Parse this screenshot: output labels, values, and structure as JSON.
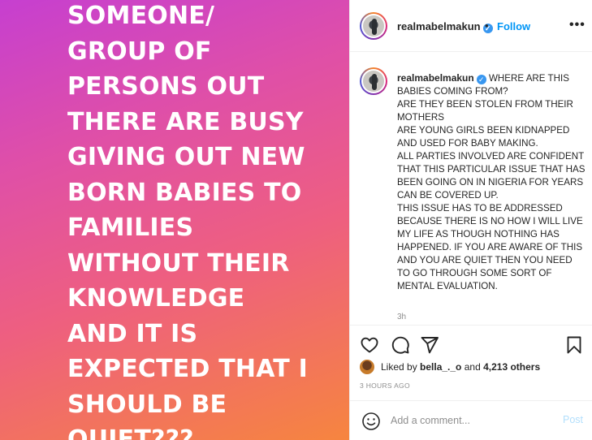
{
  "media": {
    "lines": [
      "SOMEONE/",
      "GROUP OF",
      "PERSONS OUT",
      "THERE ARE BUSY",
      "GIVING OUT NEW",
      "BORN BABIES TO",
      "FAMILIES",
      "WITHOUT THEIR",
      "KNOWLEDGE",
      "AND IT IS",
      "EXPECTED THAT I",
      "SHOULD BE",
      "QUIET???"
    ]
  },
  "header": {
    "username": "realmabelmakun",
    "separator": "•",
    "follow_label": "Follow",
    "more_label": "•••"
  },
  "caption": {
    "username": "realmabelmakun",
    "text": "WHERE ARE THIS BABIES COMING FROM?\nARE THEY BEEN STOLEN FROM THEIR MOTHERS\nARE YOUNG GIRLS BEEN KIDNAPPED AND USED FOR BABY MAKING.\nALL PARTIES INVOLVED ARE CONFIDENT THAT THIS PARTICULAR ISSUE THAT HAS BEEN GOING ON IN NIGERIA FOR YEARS CAN BE COVERED UP.\nTHIS ISSUE HAS TO BE ADDRESSED BECAUSE THERE IS NO HOW I WILL LIVE MY LIFE AS THOUGH NOTHING HAS HAPPENED. IF YOU ARE AWARE OF THIS AND YOU ARE QUIET THEN YOU NEED TO GO THROUGH SOME SORT OF MENTAL EVALUATION.",
    "time_ago": "3h"
  },
  "likes": {
    "prefix": "Liked by ",
    "user": "bella_._o",
    "middle": " and ",
    "count": "4,213 others"
  },
  "timestamp": "3 HOURS AGO",
  "comment": {
    "placeholder": "Add a comment...",
    "post_label": "Post"
  },
  "icons": {
    "like": "heart-icon",
    "comment": "comment-bubble-icon",
    "share": "paper-plane-icon",
    "save": "bookmark-icon",
    "emoji": "smiley-icon",
    "verified": "verified-badge-icon",
    "more": "ellipsis-icon"
  },
  "colors": {
    "accent": "#0095f6",
    "verified": "#3897f0",
    "muted": "#8e8e8e",
    "post_disabled": "#b2dffc"
  }
}
